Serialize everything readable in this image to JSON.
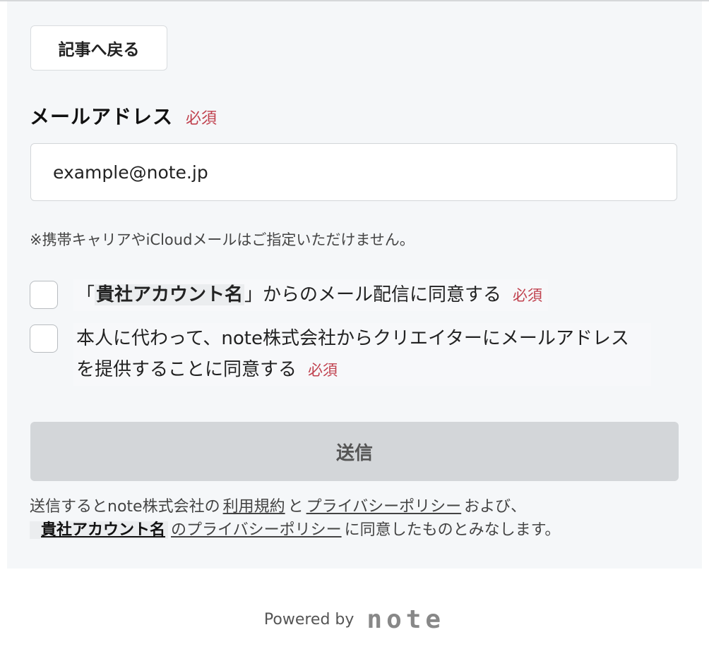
{
  "back_button": "記事へ戻る",
  "email": {
    "label": "メールアドレス",
    "required": "必須",
    "value": "example@note.jp"
  },
  "note": "※携帯キャリアやiCloudメールはご指定いただけません。",
  "consents": [
    {
      "open_bracket": "「",
      "company": "貴社アカウント名",
      "text": "」からのメール配信に同意する",
      "required": "必須"
    },
    {
      "text": "本人に代わって、note株式会社からクリエイターにメールアドレスを提供することに同意する",
      "required": "必須"
    }
  ],
  "submit_button": "送信",
  "terms": {
    "part1": "送信するとnote株式会社の",
    "terms_link": "利用規約",
    "part2": "と",
    "privacy_link": "プライバシーポリシー",
    "part3": "および、",
    "company": "貴社アカウント名",
    "company_privacy_link": "のプライバシーポリシー",
    "part4": "に同意したものとみなします。"
  },
  "footer": {
    "powered_by": "Powered by",
    "logo": "note"
  }
}
